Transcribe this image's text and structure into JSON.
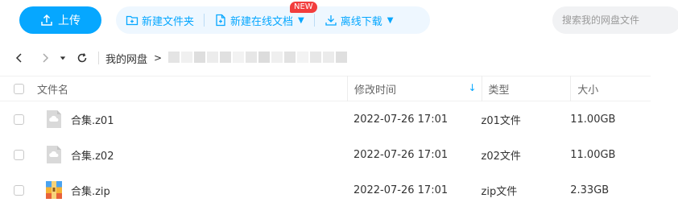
{
  "toolbar": {
    "upload_label": "上传",
    "new_folder_label": "新建文件夹",
    "new_online_doc_label": "新建在线文档",
    "new_badge": "NEW",
    "offline_download_label": "离线下载"
  },
  "search": {
    "placeholder": "搜索我的网盘文件"
  },
  "breadcrumb": {
    "root": "我的网盘",
    "separator": ">"
  },
  "columns": {
    "name": "文件名",
    "modified": "修改时间",
    "type": "类型",
    "size": "大小"
  },
  "files": [
    {
      "name": "合集.z01",
      "modified": "2022-07-26 17:01",
      "type": "z01文件",
      "size": "11.00GB",
      "icon": "archive-part-icon"
    },
    {
      "name": "合集.z02",
      "modified": "2022-07-26 17:01",
      "type": "z02文件",
      "size": "11.00GB",
      "icon": "archive-part-icon"
    },
    {
      "name": "合集.zip",
      "modified": "2022-07-26 17:01",
      "type": "zip文件",
      "size": "2.33GB",
      "icon": "zip-archive-icon"
    }
  ],
  "colors": {
    "accent": "#06a7ff",
    "accent_light": "#eef7ff",
    "badge_red": "#f23d3d"
  }
}
